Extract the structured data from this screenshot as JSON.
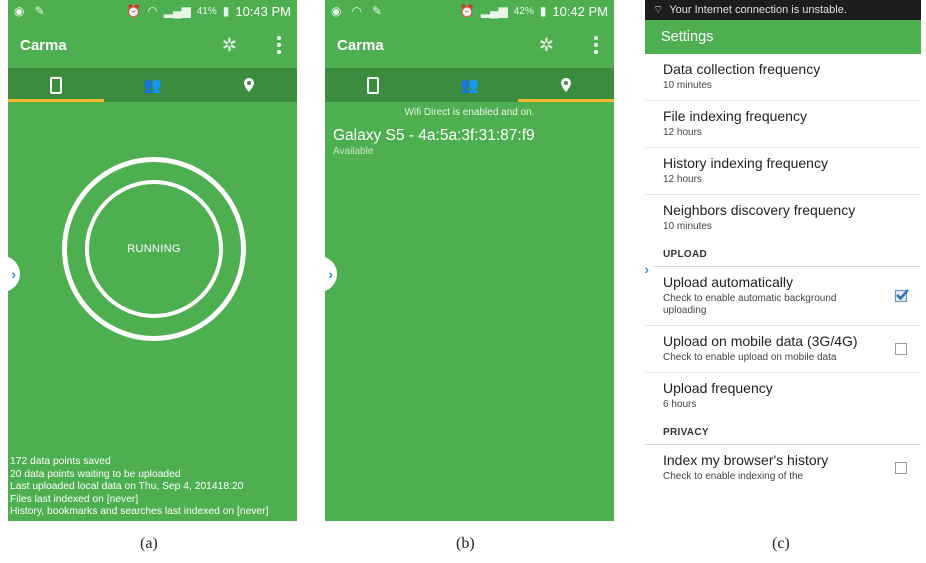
{
  "panel_a": {
    "status_time": "10:43 PM",
    "status_battery": "41%",
    "app_title": "Carma",
    "center_label": "RUNNING",
    "stats": [
      "172 data points saved",
      "20 data points waiting to be uploaded",
      "Last uploaded local data on Thu, Sep 4, 201418:20",
      "Files last indexed on [never]",
      "History, bookmarks and searches last indexed on [never]"
    ],
    "caption": "(a)"
  },
  "panel_b": {
    "status_time": "10:42 PM",
    "status_battery": "42%",
    "app_title": "Carma",
    "wifi_status": "Wifi Direct is enabled and on.",
    "device_name": "Galaxy S5 - 4a:5a:3f:31:87:f9",
    "device_state": "Available",
    "caption": "(b)"
  },
  "panel_c": {
    "status_text": "Your Internet connection is unstable.",
    "app_title": "Settings",
    "prefs_top": [
      {
        "title": "Data collection frequency",
        "summary": "10 minutes"
      },
      {
        "title": "File indexing frequency",
        "summary": "12 hours"
      },
      {
        "title": "History indexing frequency",
        "summary": "12 hours"
      },
      {
        "title": "Neighbors discovery frequency",
        "summary": "10 minutes"
      }
    ],
    "section_upload": "UPLOAD",
    "upload_auto": {
      "title": "Upload automatically",
      "summary": "Check to enable automatic background uploading",
      "checked": true
    },
    "upload_mobile": {
      "title": "Upload on mobile data (3G/4G)",
      "summary": "Check to enable upload on mobile data",
      "checked": false
    },
    "upload_freq": {
      "title": "Upload frequency",
      "summary": "6 hours"
    },
    "section_privacy": "PRIVACY",
    "privacy_history": {
      "title": "Index my browser's history",
      "summary": "Check to enable indexing of the",
      "checked": false
    },
    "caption": "(c)"
  },
  "colors": {
    "app_green": "#4daf50",
    "tab_green": "#3c8c40",
    "tab_indicator": "#f5b82e"
  }
}
